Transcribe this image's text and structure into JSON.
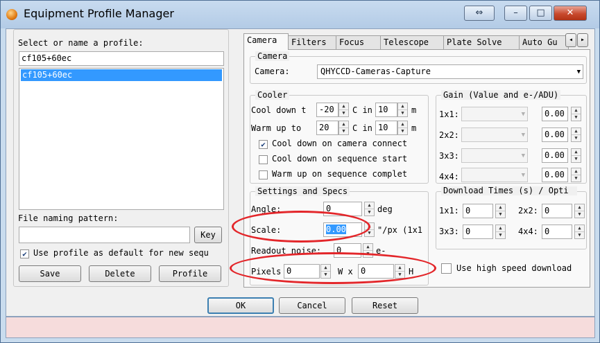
{
  "window": {
    "title": "Equipment Profile Manager",
    "buttons": {
      "extra": "⇔",
      "minimize": "–",
      "maximize": "□",
      "close": "✕"
    }
  },
  "left": {
    "profile_label": "Select or name a profile:",
    "profile_input": "cf105+60ec",
    "profiles": [
      "cf105+60ec"
    ],
    "naming_label": "File naming pattern:",
    "naming_value": "",
    "key_button": "Key",
    "default_checkbox_label": "Use profile as default for new sequ",
    "default_checked": true,
    "save_button": "Save",
    "delete_button": "Delete",
    "profile_button": "Profile"
  },
  "tabs": [
    "Camera",
    "Filters",
    "Focus",
    "Telescope",
    "Plate Solve",
    "Auto Gu"
  ],
  "tab_scroll": {
    "left": "◂",
    "right": "▸"
  },
  "camera": {
    "group_label": "Camera",
    "camera_label": "Camera:",
    "camera_value": "QHYCCD-Cameras-Capture"
  },
  "cooler": {
    "group_label": "Cooler",
    "cool_down_label": "Cool down t",
    "cool_down_temp": "-20",
    "c_in_label": "C in",
    "cool_down_minutes": "10",
    "m_label": "m",
    "warm_up_label": "Warm up to",
    "warm_up_temp": "20",
    "warm_up_minutes": "10",
    "checks": [
      {
        "label": "Cool down on camera connect",
        "checked": true
      },
      {
        "label": "Cool down on sequence start",
        "checked": false
      },
      {
        "label": "Warm up on sequence complet",
        "checked": false
      }
    ]
  },
  "gain": {
    "group_label": "Gain (Value and e-/ADU)",
    "rows": [
      {
        "label": "1x1:",
        "value": "0.00"
      },
      {
        "label": "2x2:",
        "value": "0.00"
      },
      {
        "label": "3x3:",
        "value": "0.00"
      },
      {
        "label": "4x4:",
        "value": "0.00"
      }
    ]
  },
  "settings": {
    "group_label": "Settings and Specs",
    "angle_label": "Angle:",
    "angle_value": "0",
    "angle_unit": "deg",
    "scale_label": "Scale:",
    "scale_value": "0.00",
    "scale_unit": "\"/px (1x1",
    "readout_label": "Readout noise:",
    "readout_value": "0",
    "readout_unit": "e-",
    "pixels_label": "Pixels",
    "pixels_w": "0",
    "w_x_label": "W x",
    "pixels_h": "0",
    "h_label": "H"
  },
  "download": {
    "group_label": "Download Times (s) / Opti",
    "rows": [
      {
        "label": "1x1:",
        "value": "0"
      },
      {
        "label": "2x2:",
        "value": "0"
      },
      {
        "label": "3x3:",
        "value": "0"
      },
      {
        "label": "4x4:",
        "value": "0"
      }
    ],
    "high_speed_label": "Use high speed download",
    "high_speed_checked": false
  },
  "footer": {
    "ok": "OK",
    "cancel": "Cancel",
    "reset": "Reset"
  },
  "colors": {
    "annotation": "#e3262a",
    "selection": "#3399ff",
    "status_bar": "#f6dcdc"
  }
}
